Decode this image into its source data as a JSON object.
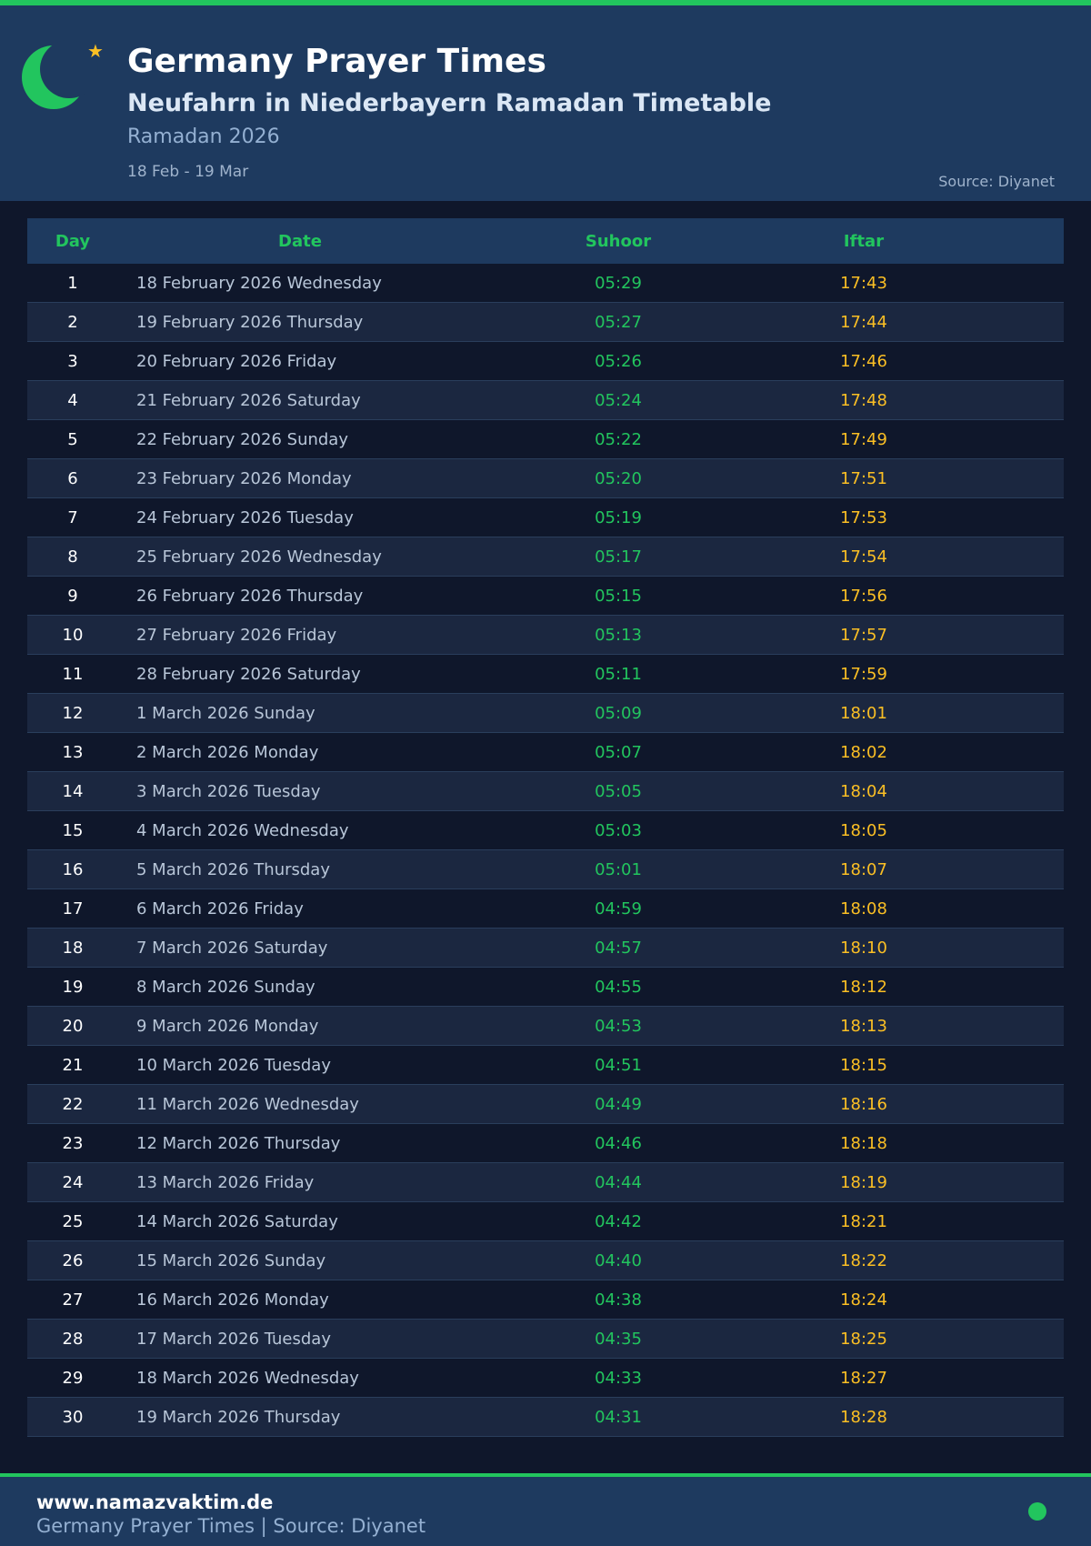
{
  "header": {
    "title": "Germany Prayer Times",
    "subtitle": "Neufahrn in Niederbayern Ramadan Timetable",
    "period": "Ramadan 2026",
    "range": "18 Feb - 19 Mar",
    "source": "Source: Diyanet",
    "icon": "crescent-moon-icon",
    "star_icon": "star-icon"
  },
  "table": {
    "columns": [
      "Day",
      "Date",
      "Suhoor",
      "Iftar"
    ],
    "rows": [
      {
        "day": "1",
        "date": "18 February 2026 Wednesday",
        "suhoor": "05:29",
        "iftar": "17:43"
      },
      {
        "day": "2",
        "date": "19 February 2026 Thursday",
        "suhoor": "05:27",
        "iftar": "17:44"
      },
      {
        "day": "3",
        "date": "20 February 2026 Friday",
        "suhoor": "05:26",
        "iftar": "17:46"
      },
      {
        "day": "4",
        "date": "21 February 2026 Saturday",
        "suhoor": "05:24",
        "iftar": "17:48"
      },
      {
        "day": "5",
        "date": "22 February 2026 Sunday",
        "suhoor": "05:22",
        "iftar": "17:49"
      },
      {
        "day": "6",
        "date": "23 February 2026 Monday",
        "suhoor": "05:20",
        "iftar": "17:51"
      },
      {
        "day": "7",
        "date": "24 February 2026 Tuesday",
        "suhoor": "05:19",
        "iftar": "17:53"
      },
      {
        "day": "8",
        "date": "25 February 2026 Wednesday",
        "suhoor": "05:17",
        "iftar": "17:54"
      },
      {
        "day": "9",
        "date": "26 February 2026 Thursday",
        "suhoor": "05:15",
        "iftar": "17:56"
      },
      {
        "day": "10",
        "date": "27 February 2026 Friday",
        "suhoor": "05:13",
        "iftar": "17:57"
      },
      {
        "day": "11",
        "date": "28 February 2026 Saturday",
        "suhoor": "05:11",
        "iftar": "17:59"
      },
      {
        "day": "12",
        "date": "1 March 2026 Sunday",
        "suhoor": "05:09",
        "iftar": "18:01"
      },
      {
        "day": "13",
        "date": "2 March 2026 Monday",
        "suhoor": "05:07",
        "iftar": "18:02"
      },
      {
        "day": "14",
        "date": "3 March 2026 Tuesday",
        "suhoor": "05:05",
        "iftar": "18:04"
      },
      {
        "day": "15",
        "date": "4 March 2026 Wednesday",
        "suhoor": "05:03",
        "iftar": "18:05"
      },
      {
        "day": "16",
        "date": "5 March 2026 Thursday",
        "suhoor": "05:01",
        "iftar": "18:07"
      },
      {
        "day": "17",
        "date": "6 March 2026 Friday",
        "suhoor": "04:59",
        "iftar": "18:08"
      },
      {
        "day": "18",
        "date": "7 March 2026 Saturday",
        "suhoor": "04:57",
        "iftar": "18:10"
      },
      {
        "day": "19",
        "date": "8 March 2026 Sunday",
        "suhoor": "04:55",
        "iftar": "18:12"
      },
      {
        "day": "20",
        "date": "9 March 2026 Monday",
        "suhoor": "04:53",
        "iftar": "18:13"
      },
      {
        "day": "21",
        "date": "10 March 2026 Tuesday",
        "suhoor": "04:51",
        "iftar": "18:15"
      },
      {
        "day": "22",
        "date": "11 March 2026 Wednesday",
        "suhoor": "04:49",
        "iftar": "18:16"
      },
      {
        "day": "23",
        "date": "12 March 2026 Thursday",
        "suhoor": "04:46",
        "iftar": "18:18"
      },
      {
        "day": "24",
        "date": "13 March 2026 Friday",
        "suhoor": "04:44",
        "iftar": "18:19"
      },
      {
        "day": "25",
        "date": "14 March 2026 Saturday",
        "suhoor": "04:42",
        "iftar": "18:21"
      },
      {
        "day": "26",
        "date": "15 March 2026 Sunday",
        "suhoor": "04:40",
        "iftar": "18:22"
      },
      {
        "day": "27",
        "date": "16 March 2026 Monday",
        "suhoor": "04:38",
        "iftar": "18:24"
      },
      {
        "day": "28",
        "date": "17 March 2026 Tuesday",
        "suhoor": "04:35",
        "iftar": "18:25"
      },
      {
        "day": "29",
        "date": "18 March 2026 Wednesday",
        "suhoor": "04:33",
        "iftar": "18:27"
      },
      {
        "day": "30",
        "date": "19 March 2026 Thursday",
        "suhoor": "04:31",
        "iftar": "18:28"
      }
    ]
  },
  "footer": {
    "url": "www.namazvaktim.de",
    "text": "Germany Prayer Times | Source: Diyanet",
    "dot_icon": "status-dot-icon"
  },
  "colors": {
    "accent": "#22c55e",
    "iftar": "#fbbf24",
    "header_bg": "#1e3a5f",
    "page_bg": "#0f172b",
    "row_alt_bg": "#1b2740"
  }
}
